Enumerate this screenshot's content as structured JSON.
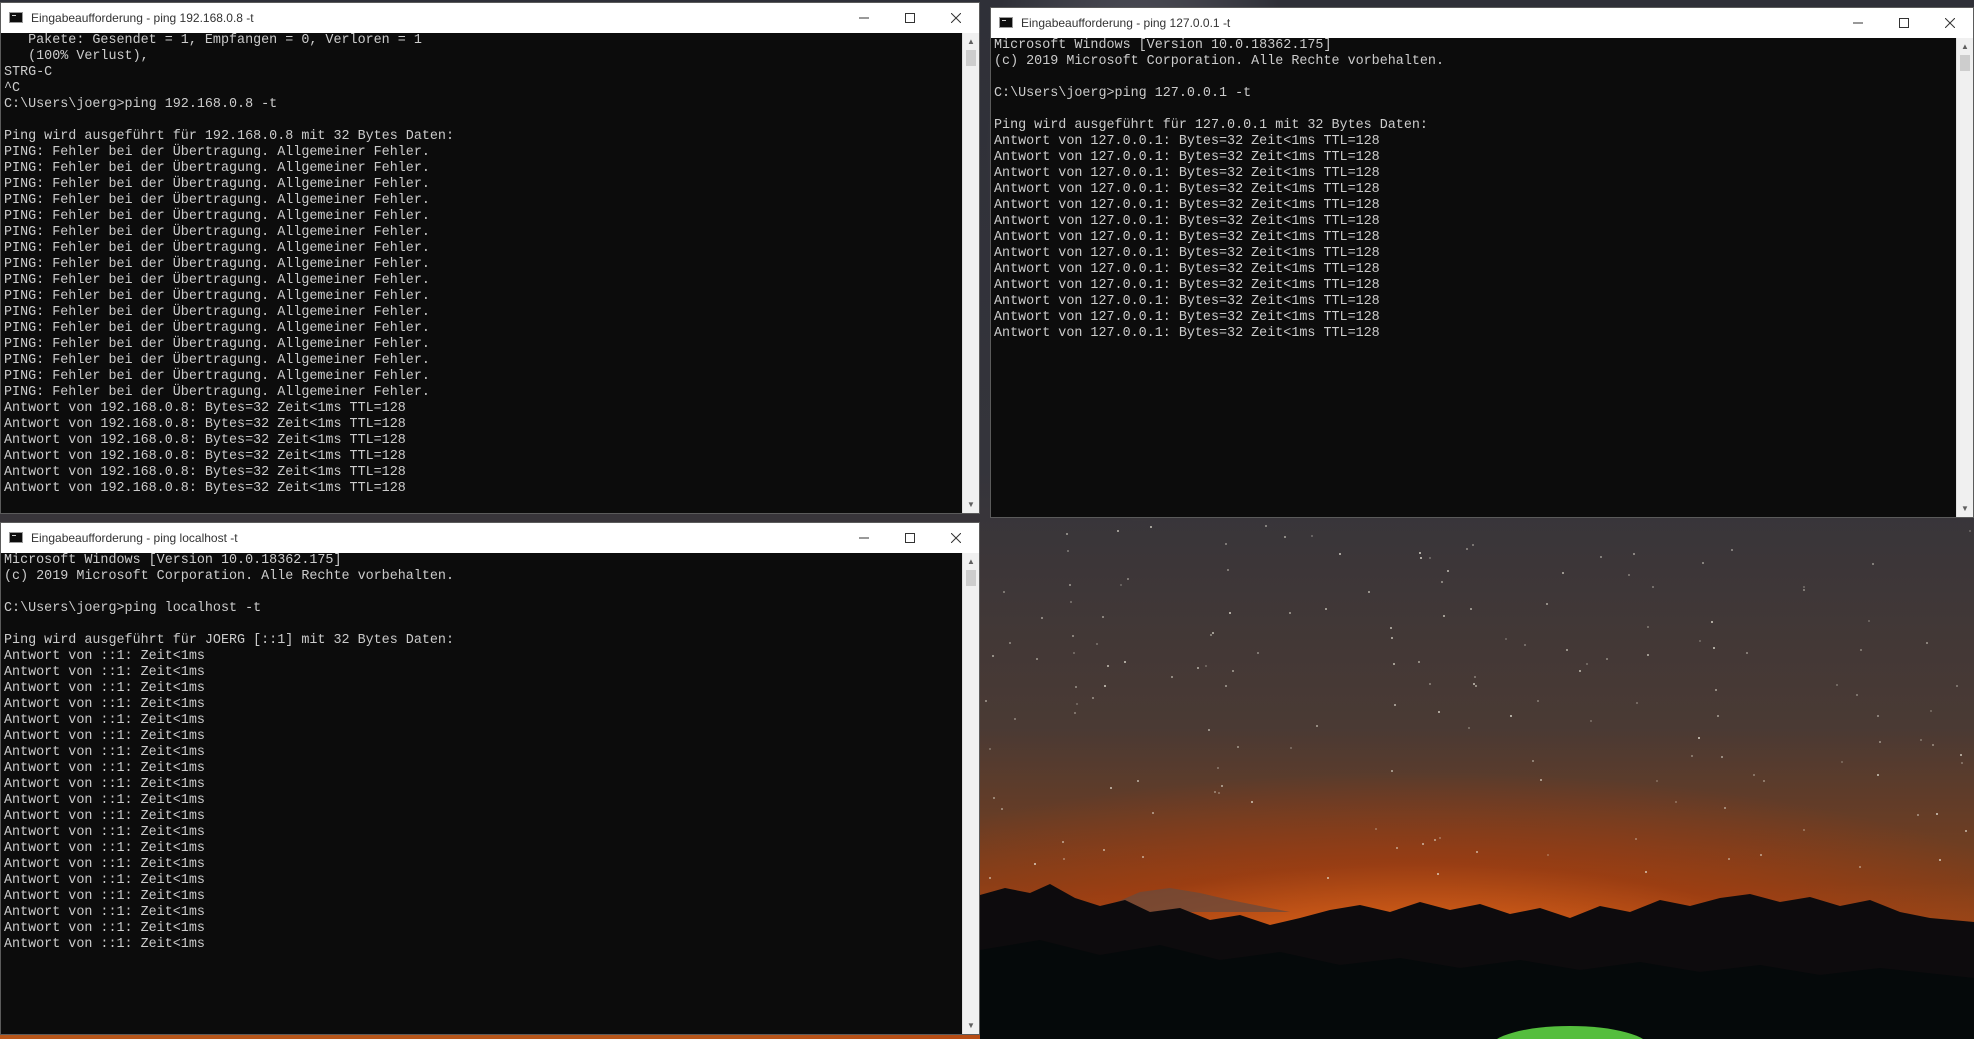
{
  "windows": [
    {
      "id": "w1",
      "title": "Eingabeaufforderung - ping  192.168.0.8 -t",
      "lines": [
        "   Pakete: Gesendet = 1, Empfangen = 0, Verloren = 1",
        "   (100% Verlust),",
        "STRG-C",
        "^C",
        "C:\\Users\\joerg>ping 192.168.0.8 -t",
        "",
        "Ping wird ausgeführt für 192.168.0.8 mit 32 Bytes Daten:",
        "PING: Fehler bei der Übertragung. Allgemeiner Fehler.",
        "PING: Fehler bei der Übertragung. Allgemeiner Fehler.",
        "PING: Fehler bei der Übertragung. Allgemeiner Fehler.",
        "PING: Fehler bei der Übertragung. Allgemeiner Fehler.",
        "PING: Fehler bei der Übertragung. Allgemeiner Fehler.",
        "PING: Fehler bei der Übertragung. Allgemeiner Fehler.",
        "PING: Fehler bei der Übertragung. Allgemeiner Fehler.",
        "PING: Fehler bei der Übertragung. Allgemeiner Fehler.",
        "PING: Fehler bei der Übertragung. Allgemeiner Fehler.",
        "PING: Fehler bei der Übertragung. Allgemeiner Fehler.",
        "PING: Fehler bei der Übertragung. Allgemeiner Fehler.",
        "PING: Fehler bei der Übertragung. Allgemeiner Fehler.",
        "PING: Fehler bei der Übertragung. Allgemeiner Fehler.",
        "PING: Fehler bei der Übertragung. Allgemeiner Fehler.",
        "PING: Fehler bei der Übertragung. Allgemeiner Fehler.",
        "PING: Fehler bei der Übertragung. Allgemeiner Fehler.",
        "Antwort von 192.168.0.8: Bytes=32 Zeit<1ms TTL=128",
        "Antwort von 192.168.0.8: Bytes=32 Zeit<1ms TTL=128",
        "Antwort von 192.168.0.8: Bytes=32 Zeit<1ms TTL=128",
        "Antwort von 192.168.0.8: Bytes=32 Zeit<1ms TTL=128",
        "Antwort von 192.168.0.8: Bytes=32 Zeit<1ms TTL=128",
        "Antwort von 192.168.0.8: Bytes=32 Zeit<1ms TTL=128"
      ]
    },
    {
      "id": "w2",
      "title": "Eingabeaufforderung - ping  127.0.0.1 -t",
      "lines": [
        "Microsoft Windows [Version 10.0.18362.175]",
        "(c) 2019 Microsoft Corporation. Alle Rechte vorbehalten.",
        "",
        "C:\\Users\\joerg>ping 127.0.0.1 -t",
        "",
        "Ping wird ausgeführt für 127.0.0.1 mit 32 Bytes Daten:",
        "Antwort von 127.0.0.1: Bytes=32 Zeit<1ms TTL=128",
        "Antwort von 127.0.0.1: Bytes=32 Zeit<1ms TTL=128",
        "Antwort von 127.0.0.1: Bytes=32 Zeit<1ms TTL=128",
        "Antwort von 127.0.0.1: Bytes=32 Zeit<1ms TTL=128",
        "Antwort von 127.0.0.1: Bytes=32 Zeit<1ms TTL=128",
        "Antwort von 127.0.0.1: Bytes=32 Zeit<1ms TTL=128",
        "Antwort von 127.0.0.1: Bytes=32 Zeit<1ms TTL=128",
        "Antwort von 127.0.0.1: Bytes=32 Zeit<1ms TTL=128",
        "Antwort von 127.0.0.1: Bytes=32 Zeit<1ms TTL=128",
        "Antwort von 127.0.0.1: Bytes=32 Zeit<1ms TTL=128",
        "Antwort von 127.0.0.1: Bytes=32 Zeit<1ms TTL=128",
        "Antwort von 127.0.0.1: Bytes=32 Zeit<1ms TTL=128",
        "Antwort von 127.0.0.1: Bytes=32 Zeit<1ms TTL=128"
      ]
    },
    {
      "id": "w3",
      "title": "Eingabeaufforderung - ping  localhost -t",
      "lines": [
        "Microsoft Windows [Version 10.0.18362.175]",
        "(c) 2019 Microsoft Corporation. Alle Rechte vorbehalten.",
        "",
        "C:\\Users\\joerg>ping localhost -t",
        "",
        "Ping wird ausgeführt für JOERG [::1] mit 32 Bytes Daten:",
        "Antwort von ::1: Zeit<1ms",
        "Antwort von ::1: Zeit<1ms",
        "Antwort von ::1: Zeit<1ms",
        "Antwort von ::1: Zeit<1ms",
        "Antwort von ::1: Zeit<1ms",
        "Antwort von ::1: Zeit<1ms",
        "Antwort von ::1: Zeit<1ms",
        "Antwort von ::1: Zeit<1ms",
        "Antwort von ::1: Zeit<1ms",
        "Antwort von ::1: Zeit<1ms",
        "Antwort von ::1: Zeit<1ms",
        "Antwort von ::1: Zeit<1ms",
        "Antwort von ::1: Zeit<1ms",
        "Antwort von ::1: Zeit<1ms",
        "Antwort von ::1: Zeit<1ms",
        "Antwort von ::1: Zeit<1ms",
        "Antwort von ::1: Zeit<1ms",
        "Antwort von ::1: Zeit<1ms",
        "Antwort von ::1: Zeit<1ms"
      ]
    }
  ],
  "window_controls": {
    "minimize": "minimize-icon",
    "maximize": "maximize-icon",
    "close": "close-icon"
  },
  "colors": {
    "console_bg": "#0c0c0c",
    "console_text": "#cccccc",
    "titlebar_bg": "#ffffff"
  }
}
